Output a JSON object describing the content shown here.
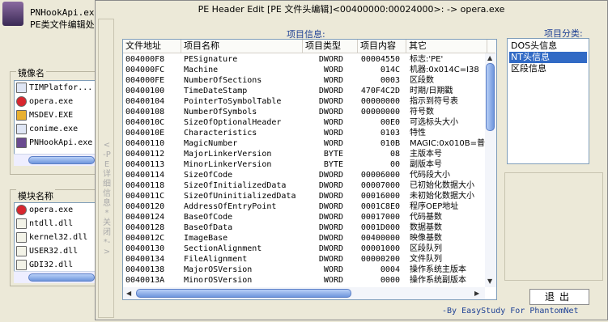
{
  "background_window": {
    "title_line1": "PNHookApi.exe",
    "title_line2": "PE类文件编辑处",
    "image_group_label": "镜像名",
    "images": [
      {
        "name": "TIMPlatfor...",
        "icon": "window-icon"
      },
      {
        "name": "opera.exe",
        "icon": "opera-icon"
      },
      {
        "name": "MSDEV.EXE",
        "icon": "msdev-icon"
      },
      {
        "name": "conime.exe",
        "icon": "window-icon"
      },
      {
        "name": "PNHookApi.exe",
        "icon": "app-icon"
      }
    ],
    "module_group_label": "模块名称",
    "modules": [
      {
        "name": "opera.exe",
        "icon": "opera-icon"
      },
      {
        "name": "ntdll.dll",
        "icon": "dll-icon"
      },
      {
        "name": "kernel32.dll",
        "icon": "dll-icon"
      },
      {
        "name": "USER32.dll",
        "icon": "dll-icon"
      },
      {
        "name": "GDI32.dll",
        "icon": "dll-icon"
      }
    ]
  },
  "dialog": {
    "title": "PE Header Edit [PE 文件头编辑]<00400000:00024000>: -> opera.exe",
    "side_button_text": "<-PE详细信息*关闭*->",
    "info_label": "项目信息:",
    "category_label": "项目分类:",
    "columns": [
      "文件地址",
      "项目名称",
      "项目类型",
      "项目内容",
      "其它"
    ],
    "rows": [
      [
        "004000F8",
        "PESignature",
        "DWORD",
        "00004550",
        "标志:'PE'"
      ],
      [
        "004000FC",
        "Machine",
        "WORD",
        "014C",
        "机器:0x014C=I38"
      ],
      [
        "004000FE",
        "NumberOfSections",
        "WORD",
        "0003",
        "区段数"
      ],
      [
        "00400100",
        "TimeDateStamp",
        "DWORD",
        "470F4C2D",
        "时期/日期戳"
      ],
      [
        "00400104",
        "PointerToSymbolTable",
        "DWORD",
        "00000000",
        "指示到符号表"
      ],
      [
        "00400108",
        "NumberOfSymbols",
        "DWORD",
        "00000000",
        "符号数"
      ],
      [
        "0040010C",
        "SizeOfOptionalHeader",
        "WORD",
        "00E0",
        "可选标头大小"
      ],
      [
        "0040010E",
        "Characteristics",
        "WORD",
        "0103",
        "特性"
      ],
      [
        "00400110",
        "MagicNumber",
        "WORD",
        "010B",
        "MAGIC:0x010B=普"
      ],
      [
        "00400112",
        "MajorLinkerVersion",
        "BYTE",
        "08",
        "主版本号"
      ],
      [
        "00400113",
        "MinorLinkerVersion",
        "BYTE",
        "00",
        "副版本号"
      ],
      [
        "00400114",
        "SizeOfCode",
        "DWORD",
        "00006000",
        "代码段大小"
      ],
      [
        "00400118",
        "SizeOfInitializedData",
        "DWORD",
        "00007000",
        "已初始化数据大小"
      ],
      [
        "0040011C",
        "SizeOfUninitializedData",
        "DWORD",
        "00016000",
        "未初始化数据大小"
      ],
      [
        "00400120",
        "AddressOfEntryPoint",
        "DWORD",
        "0001C8E0",
        "程序OEP地址"
      ],
      [
        "00400124",
        "BaseOfCode",
        "DWORD",
        "00017000",
        "代码基数"
      ],
      [
        "00400128",
        "BaseOfData",
        "DWORD",
        "0001D000",
        "数据基数"
      ],
      [
        "0040012C",
        "ImageBase",
        "DWORD",
        "00400000",
        "映像基数"
      ],
      [
        "00400130",
        "SectionAlignment",
        "DWORD",
        "00001000",
        "区段队列"
      ],
      [
        "00400134",
        "FileAlignment",
        "DWORD",
        "00000200",
        "文件队列"
      ],
      [
        "00400138",
        "MajorOSVersion",
        "WORD",
        "0004",
        "操作系统主版本"
      ],
      [
        "0040013A",
        "MinorOSVersion",
        "WORD",
        "0000",
        "操作系统副版本"
      ]
    ],
    "categories": [
      {
        "label": "DOS头信息",
        "selected": false
      },
      {
        "label": "NT头信息",
        "selected": true
      },
      {
        "label": "区段信息",
        "selected": false
      }
    ],
    "exit_button": "退出",
    "credit": "-By EasyStudy For PhantomNet"
  },
  "colors": {
    "accent": "#1c3f94",
    "selection": "#316ac5",
    "face": "#ece9d8"
  }
}
